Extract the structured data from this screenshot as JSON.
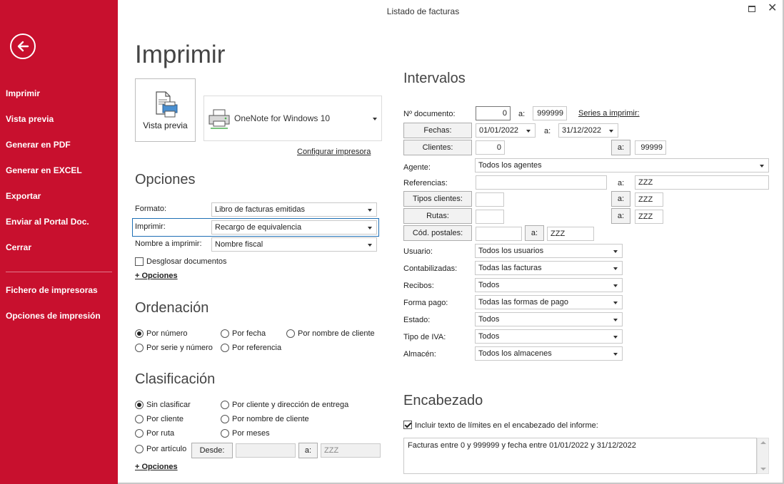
{
  "window": {
    "title": "Listado de facturas"
  },
  "sidebar": {
    "items": [
      {
        "label": "Imprimir"
      },
      {
        "label": "Vista previa"
      },
      {
        "label": "Generar en PDF"
      },
      {
        "label": "Generar en EXCEL"
      },
      {
        "label": "Exportar"
      },
      {
        "label": "Enviar al Portal Doc."
      },
      {
        "label": "Cerrar"
      },
      {
        "label": "Fichero de impresoras"
      },
      {
        "label": "Opciones de impresión"
      }
    ]
  },
  "page": {
    "title": "Imprimir"
  },
  "preview": {
    "label": "Vista previa"
  },
  "printer": {
    "name": "OneNote for Windows 10",
    "configure_link": "Configurar impresora"
  },
  "opciones": {
    "title": "Opciones",
    "formato": {
      "label": "Formato:",
      "value": "Libro de facturas emitidas"
    },
    "imprimir": {
      "label": "Imprimir:",
      "value": "Recargo de equivalencia"
    },
    "nombre": {
      "label": "Nombre a imprimir:",
      "value": "Nombre fiscal"
    },
    "desglosar": {
      "label": "Desglosar documentos",
      "checked": false
    },
    "more": "+ Opciones"
  },
  "ordenacion": {
    "title": "Ordenación",
    "options": [
      {
        "label": "Por número",
        "checked": true
      },
      {
        "label": "Por fecha",
        "checked": false
      },
      {
        "label": "Por nombre de cliente",
        "checked": false
      },
      {
        "label": "Por serie y número",
        "checked": false
      },
      {
        "label": "Por referencia",
        "checked": false
      }
    ]
  },
  "clasificacion": {
    "title": "Clasificación",
    "options": [
      {
        "label": "Sin clasificar",
        "checked": true
      },
      {
        "label": "Por cliente y dirección de entrega",
        "checked": false
      },
      {
        "label": "Por cliente",
        "checked": false
      },
      {
        "label": "Por nombre de cliente",
        "checked": false
      },
      {
        "label": "Por ruta",
        "checked": false
      },
      {
        "label": "Por meses",
        "checked": false
      },
      {
        "label": "Por artículo",
        "checked": false
      }
    ],
    "desde": {
      "label": "Desde:",
      "value": ""
    },
    "hasta": {
      "label": "a:",
      "value": "ZZZ"
    },
    "more": "+ Opciones"
  },
  "intervalos": {
    "title": "Intervalos",
    "documento": {
      "label": "Nº documento:",
      "from": "0",
      "to_label": "a:",
      "to": "999999",
      "series_link": "Series a imprimir:"
    },
    "fechas": {
      "label": "Fechas:",
      "from": "01/01/2022",
      "to_label": "a:",
      "to": "31/12/2022"
    },
    "clientes": {
      "label": "Clientes:",
      "from": "0",
      "to_label": "a:",
      "to": "99999"
    },
    "agente": {
      "label": "Agente:",
      "value": "Todos los agentes"
    },
    "referencias": {
      "label": "Referencias:",
      "from": "",
      "to_label": "a:",
      "to": "ZZZ"
    },
    "tipos_clientes": {
      "label": "Tipos clientes:",
      "from": "",
      "to_label": "a:",
      "to": "ZZZ"
    },
    "rutas": {
      "label": "Rutas:",
      "from": "",
      "to_label": "a:",
      "to": "ZZZ"
    },
    "cod_postales": {
      "label": "Cód. postales:",
      "from": "",
      "to_label": "a:",
      "to": "ZZZ"
    },
    "usuario": {
      "label": "Usuario:",
      "value": "Todos los usuarios"
    },
    "contabilizadas": {
      "label": "Contabilizadas:",
      "value": "Todas las facturas"
    },
    "recibos": {
      "label": "Recibos:",
      "value": "Todos"
    },
    "forma_pago": {
      "label": "Forma pago:",
      "value": "Todas las formas de pago"
    },
    "estado": {
      "label": "Estado:",
      "value": "Todos"
    },
    "tipo_iva": {
      "label": "Tipo de IVA:",
      "value": "Todos"
    },
    "almacen": {
      "label": "Almacén:",
      "value": "Todos los almacenes"
    }
  },
  "encabezado": {
    "title": "Encabezado",
    "include": {
      "label": "Incluir texto de límites en el encabezado del informe:",
      "checked": true
    },
    "text": "Facturas entre 0 y 999999 y fecha entre 01/01/2022 y 31/12/2022"
  },
  "colors": {
    "accent": "#c8102e",
    "focus": "#1e6fb5"
  },
  "icons": {
    "back": "arrow-left-circle",
    "printer": "printer",
    "preview": "document-printer"
  }
}
